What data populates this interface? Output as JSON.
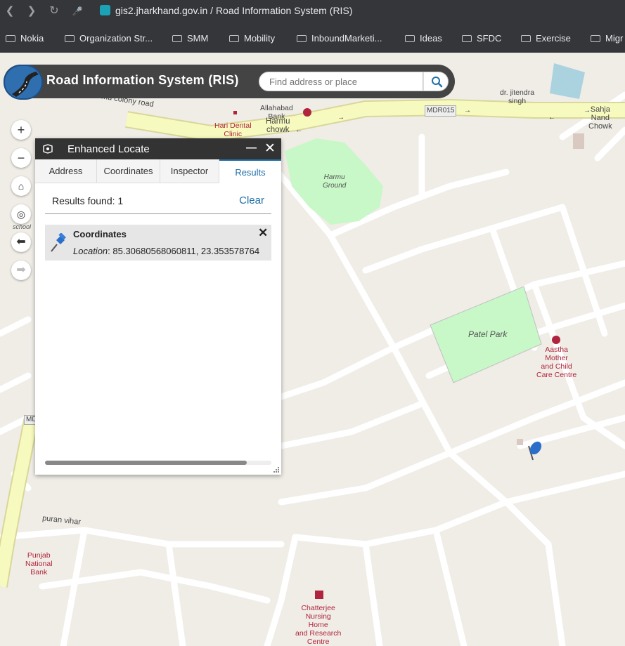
{
  "browser": {
    "url": "gis2.jharkhand.gov.in / Road Information System (RIS)",
    "bookmarks": [
      "Nokia",
      "Organization Str...",
      "SMM",
      "Mobility",
      "InboundMarketi...",
      "Ideas",
      "SFDC",
      "Exercise",
      "Migr"
    ]
  },
  "app": {
    "title": "Road Information System (RIS)",
    "search_placeholder": "Find address or place"
  },
  "map_labels": {
    "harmu_colony_road": "harmu colony road",
    "allahabad_bank": "Allahabad\nBank",
    "hari_dental": "Hari Dental\nClinic",
    "harmu_chowk": "Harmu\nchowk",
    "mdr015": "MDR015",
    "jitendra": "dr. jitendra\nsingh",
    "sahja_nand": "Sahja\nNand\nChowk",
    "harmu_ground": "Harmu\nGround",
    "patel_park": "Patel Park",
    "aastha": "Aastha\nMother\nand Child\nCare Centre",
    "school": "school",
    "md": "MD",
    "puran_vihar": "puran vihar",
    "punjab_bank": "Punjab\nNational\nBank",
    "chatterjee": "Chatterjee\nNursing\nHome\nand Research\nCentre"
  },
  "panel": {
    "title": "Enhanced Locate",
    "tabs": [
      "Address",
      "Coordinates",
      "Inspector",
      "Results"
    ],
    "active_tab": "Results",
    "results_found": "Results found: 1",
    "clear": "Clear",
    "result": {
      "title": "Coordinates",
      "location_label": "Location",
      "location_value": ": 85.30680568060811, 23.353578764"
    }
  },
  "colors": {
    "accent": "#2070a8",
    "park": "#c8f7c8",
    "road_major": "#f7fabf",
    "map_bg": "#f0ede7"
  }
}
